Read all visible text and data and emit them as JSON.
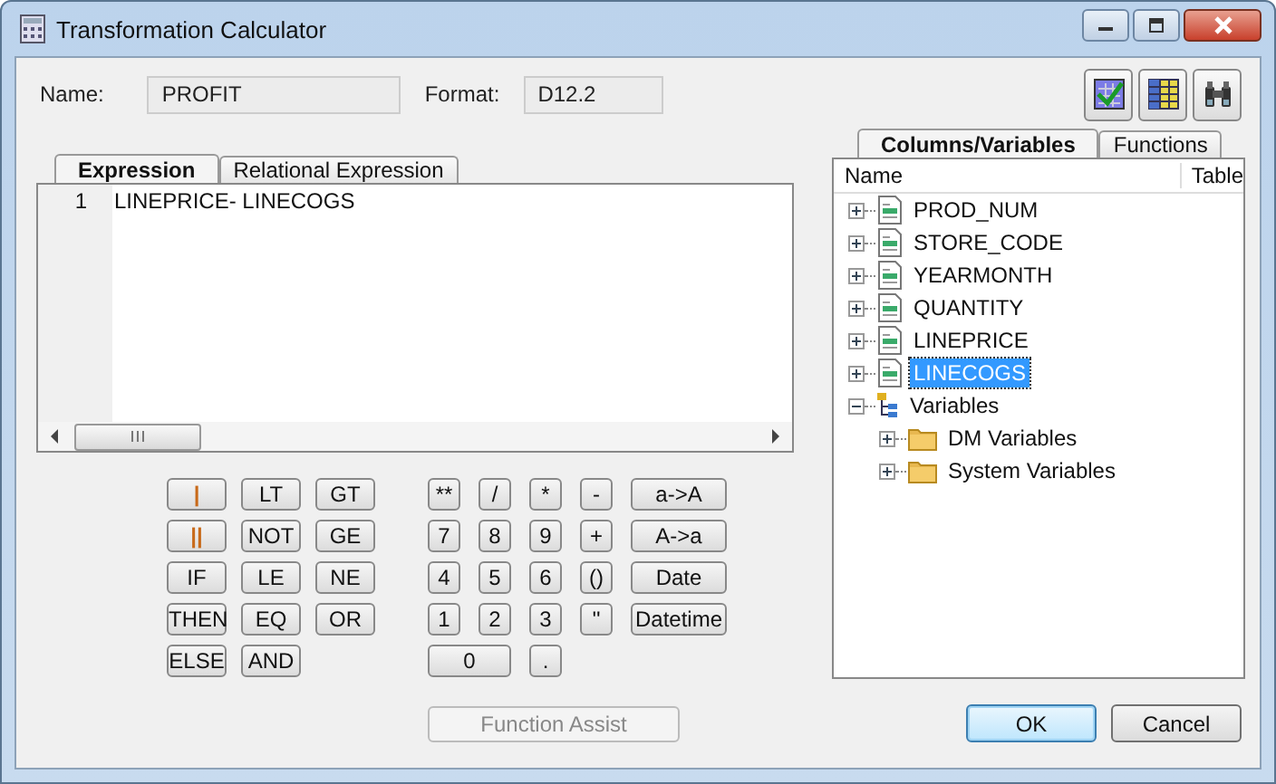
{
  "window": {
    "title": "Transformation Calculator"
  },
  "name_field": {
    "label": "Name:",
    "value": "PROFIT"
  },
  "format_field": {
    "label": "Format:",
    "value": "D12.2"
  },
  "expression_tabs": [
    {
      "label": "Expression",
      "selected": true
    },
    {
      "label": "Relational Expression",
      "selected": false
    }
  ],
  "editor": {
    "lines": [
      {
        "number": "1",
        "text": "LINEPRICE- LINECOGS"
      }
    ]
  },
  "operator_keys": [
    [
      {
        "label": "|",
        "kind": "orange"
      },
      {
        "label": "LT",
        "kind": "plain"
      },
      {
        "label": "GT",
        "kind": "plain"
      }
    ],
    [
      {
        "label": "||",
        "kind": "orange"
      },
      {
        "label": "NOT",
        "kind": "plain"
      },
      {
        "label": "GE",
        "kind": "plain"
      }
    ],
    [
      {
        "label": "IF",
        "kind": "plain"
      },
      {
        "label": "LE",
        "kind": "plain"
      },
      {
        "label": "NE",
        "kind": "plain"
      }
    ],
    [
      {
        "label": "THEN",
        "kind": "plain"
      },
      {
        "label": "EQ",
        "kind": "plain"
      },
      {
        "label": "OR",
        "kind": "plain"
      }
    ],
    [
      {
        "label": "ELSE",
        "kind": "plain"
      },
      {
        "label": "AND",
        "kind": "plain"
      }
    ]
  ],
  "number_keys": [
    [
      {
        "label": "**",
        "kind": "narrow"
      },
      {
        "label": "/",
        "kind": "narrow"
      },
      {
        "label": "*",
        "kind": "narrow"
      },
      {
        "label": "-",
        "kind": "narrow"
      },
      {
        "label": "a->A",
        "kind": "wide"
      }
    ],
    [
      {
        "label": "7",
        "kind": "narrow"
      },
      {
        "label": "8",
        "kind": "narrow"
      },
      {
        "label": "9",
        "kind": "narrow"
      },
      {
        "label": "+",
        "kind": "narrow"
      },
      {
        "label": "A->a",
        "kind": "wide"
      }
    ],
    [
      {
        "label": "4",
        "kind": "narrow"
      },
      {
        "label": "5",
        "kind": "narrow"
      },
      {
        "label": "6",
        "kind": "narrow"
      },
      {
        "label": "()",
        "kind": "narrow"
      },
      {
        "label": "Date",
        "kind": "wide"
      }
    ],
    [
      {
        "label": "1",
        "kind": "narrow"
      },
      {
        "label": "2",
        "kind": "narrow"
      },
      {
        "label": "3",
        "kind": "narrow"
      },
      {
        "label": "''",
        "kind": "narrow"
      },
      {
        "label": "Datetime",
        "kind": "wide"
      }
    ],
    [
      {
        "label": "0",
        "kind": "double"
      },
      {
        "label": ".",
        "kind": "narrow"
      }
    ]
  ],
  "function_assist": {
    "label": "Function Assist",
    "disabled": true
  },
  "side_tabs": [
    {
      "label": "Columns/Variables",
      "selected": true
    },
    {
      "label": "Functions",
      "selected": false
    }
  ],
  "tree": {
    "columns": [
      "Name",
      "Table"
    ],
    "items": [
      {
        "label": "PROD_NUM",
        "kind": "column",
        "expanded": false,
        "selected": false
      },
      {
        "label": "STORE_CODE",
        "kind": "column",
        "expanded": false,
        "selected": false
      },
      {
        "label": "YEARMONTH",
        "kind": "column",
        "expanded": false,
        "selected": false
      },
      {
        "label": "QUANTITY",
        "kind": "column",
        "expanded": false,
        "selected": false
      },
      {
        "label": "LINEPRICE",
        "kind": "column",
        "expanded": false,
        "selected": false
      },
      {
        "label": "LINECOGS",
        "kind": "column",
        "expanded": false,
        "selected": true
      },
      {
        "label": "Variables",
        "kind": "group",
        "expanded": true,
        "selected": false,
        "children": [
          {
            "label": "DM Variables",
            "kind": "folder",
            "expanded": false,
            "selected": false
          },
          {
            "label": "System Variables",
            "kind": "folder",
            "expanded": false,
            "selected": false
          }
        ]
      }
    ]
  },
  "buttons": [
    {
      "label": "OK",
      "kind": "default"
    },
    {
      "label": "Cancel",
      "kind": "normal"
    }
  ]
}
